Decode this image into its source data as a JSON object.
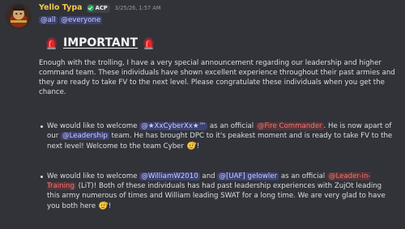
{
  "message": {
    "author": "Yello Typa",
    "badge": "ACP",
    "timestamp": "3/25/26, 1:57 AM",
    "mentions": [
      "@all",
      "@everyone"
    ],
    "heading": "IMPORTANT",
    "intro": "Enough with the trolling, I have a very special announcement regarding our leadership and higher command team. These individuals have shown excellent experience throughout their past armies and they are ready to take FV to the next level. Please congratulate these individuals when you get the chance.",
    "bullet1": {
      "p1": "We would like to welcome ",
      "user": "@★XxCyberXx★™",
      "p2": " as an official ",
      "role": "@Fire Commander",
      "p3": ". He is now apart of our ",
      "role2": "@Leadership",
      "p4": " team. He has brought DPC to it's peakest moment and is ready to take FV to the next level! Welcome to the team Cyber ",
      "p5": "!"
    },
    "bullet2": {
      "p1": "We would like to welcome ",
      "user1": "@WilliamW2010",
      "p2": " and ",
      "user2": "@[UAF] gelowler",
      "p3": " as an official ",
      "role": "@Leader-in-Training",
      "p4": " (LiT)! Both of these individuals has had past leadership experiences with ZujOt leading this army numerous of times and William leading SWAT for a long time. We are very glad to have you both here ",
      "p5": "!"
    }
  },
  "colors": {
    "background": "#313338",
    "username": "#f2c94c",
    "mention_blue": "#c9cdfb",
    "mention_red": "#f7766f"
  },
  "icons": [
    "avatar-icon",
    "check-badge-icon",
    "siren-icon",
    "salute-emoji-icon"
  ]
}
